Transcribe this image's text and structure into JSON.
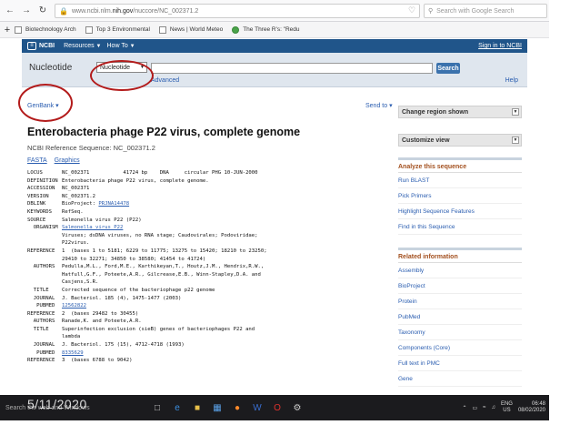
{
  "browser": {
    "url_prefix": "www.ncbi.nlm.",
    "url_host": "nih.gov",
    "url_path": "/nuccore/NC_002371.2",
    "search_placeholder": "Search with Google Search"
  },
  "bookmarks": [
    "Biotechnology Arch",
    "Top 3 Environmental",
    "News | World Meteo",
    "The Three R's: \"Redu"
  ],
  "ncbi_header": {
    "logo": "NCBI",
    "resources": "Resources",
    "howto": "How To",
    "signin": "Sign in to NCBI"
  },
  "search": {
    "db_label": "Nucleotide",
    "db_selected": "Nucleotide",
    "button": "Search",
    "advanced": "Advanced",
    "help": "Help"
  },
  "record": {
    "format": "GenBank",
    "send_to": "Send to",
    "title": "Enterobacteria phage P22 virus, complete genome",
    "refseq": "NCBI Reference Sequence: NC_002371.2",
    "links": [
      "FASTA",
      "Graphics"
    ]
  },
  "genbank": [
    {
      "key": "LOCUS",
      "val": "NC_002371           41724 bp    DNA     circular PHG 10-JUN-2000"
    },
    {
      "key": "DEFINITION",
      "val": "Enterobacteria phage P22 virus, complete genome."
    },
    {
      "key": "ACCESSION",
      "val": "NC_002371"
    },
    {
      "key": "VERSION",
      "val": "NC_002371.2"
    },
    {
      "key": "DBLINK",
      "val": "BioProject: ",
      "link": "PRJNA14478"
    },
    {
      "key": "KEYWORDS",
      "val": "RefSeq."
    },
    {
      "key": "SOURCE",
      "val": "Salmonella virus P22 (P22)"
    },
    {
      "key": "  ORGANISM",
      "val": "",
      "link": "Salmonella virus P22"
    },
    {
      "key": "",
      "val": "Viruses; dsDNA viruses, no RNA stage; Caudovirales; Podoviridae;"
    },
    {
      "key": "",
      "val": "P22virus."
    },
    {
      "key": "REFERENCE",
      "val": "1  (bases 1 to 5181; 6229 to 11775; 13275 to 15420; 18210 to 23250;"
    },
    {
      "key": "",
      "val": "29410 to 32271; 34850 to 38580; 41454 to 41724)"
    },
    {
      "key": "  AUTHORS",
      "val": "Pedulla,M.L., Ford,M.E., Karthikeyan,T., Houtz,J.M., Hendrix,R.W.,"
    },
    {
      "key": "",
      "val": "Hatfull,G.F., Poteete,A.R., Gilcrease,E.B., Winn-Stapley,D.A. and"
    },
    {
      "key": "",
      "val": "Casjens,S.R."
    },
    {
      "key": "  TITLE",
      "val": "Corrected sequence of the bacteriophage p22 genome"
    },
    {
      "key": "  JOURNAL",
      "val": "J. Bacteriol. 185 (4), 1475-1477 (2003)"
    },
    {
      "key": "   PUBMED",
      "val": "",
      "link": "12562822"
    },
    {
      "key": "REFERENCE",
      "val": "2  (bases 29482 to 30455)"
    },
    {
      "key": "  AUTHORS",
      "val": "Ranade,K. and Poteete,A.R."
    },
    {
      "key": "  TITLE",
      "val": "Superinfection exclusion (sieB) genes of bacteriophages P22 and"
    },
    {
      "key": "",
      "val": "lambda"
    },
    {
      "key": "  JOURNAL",
      "val": "J. Bacteriol. 175 (15), 4712-4718 (1993)"
    },
    {
      "key": "   PUBMED",
      "val": "",
      "link": "8335629"
    },
    {
      "key": "REFERENCE",
      "val": "3  (bases 6788 to 9042)"
    }
  ],
  "sidebar": {
    "change_region": "Change region shown",
    "customize": "Customize view",
    "analyze_head": "Analyze this sequence",
    "analyze_items": [
      "Run BLAST",
      "Pick Primers",
      "Highlight Sequence Features",
      "Find in this Sequence"
    ],
    "related_head": "Related information",
    "related_items": [
      "Assembly",
      "BioProject",
      "Protein",
      "PubMed",
      "Taxonomy",
      "Components (Core)",
      "Full text in PMC",
      "Gene"
    ]
  },
  "taskbar": {
    "search_text": "Search the web and Windows",
    "date_overlay": "5/11/2020",
    "lang_top": "ENG",
    "lang_bottom": "US",
    "time": "06:48",
    "date": "08/02/2020"
  },
  "colors": {
    "ncbi_blue": "#20558a",
    "search_bg": "#dfe6ee",
    "annotation_red": "#b31b1b",
    "link_blue": "#2a5db0",
    "section_head": "#a3501f"
  }
}
